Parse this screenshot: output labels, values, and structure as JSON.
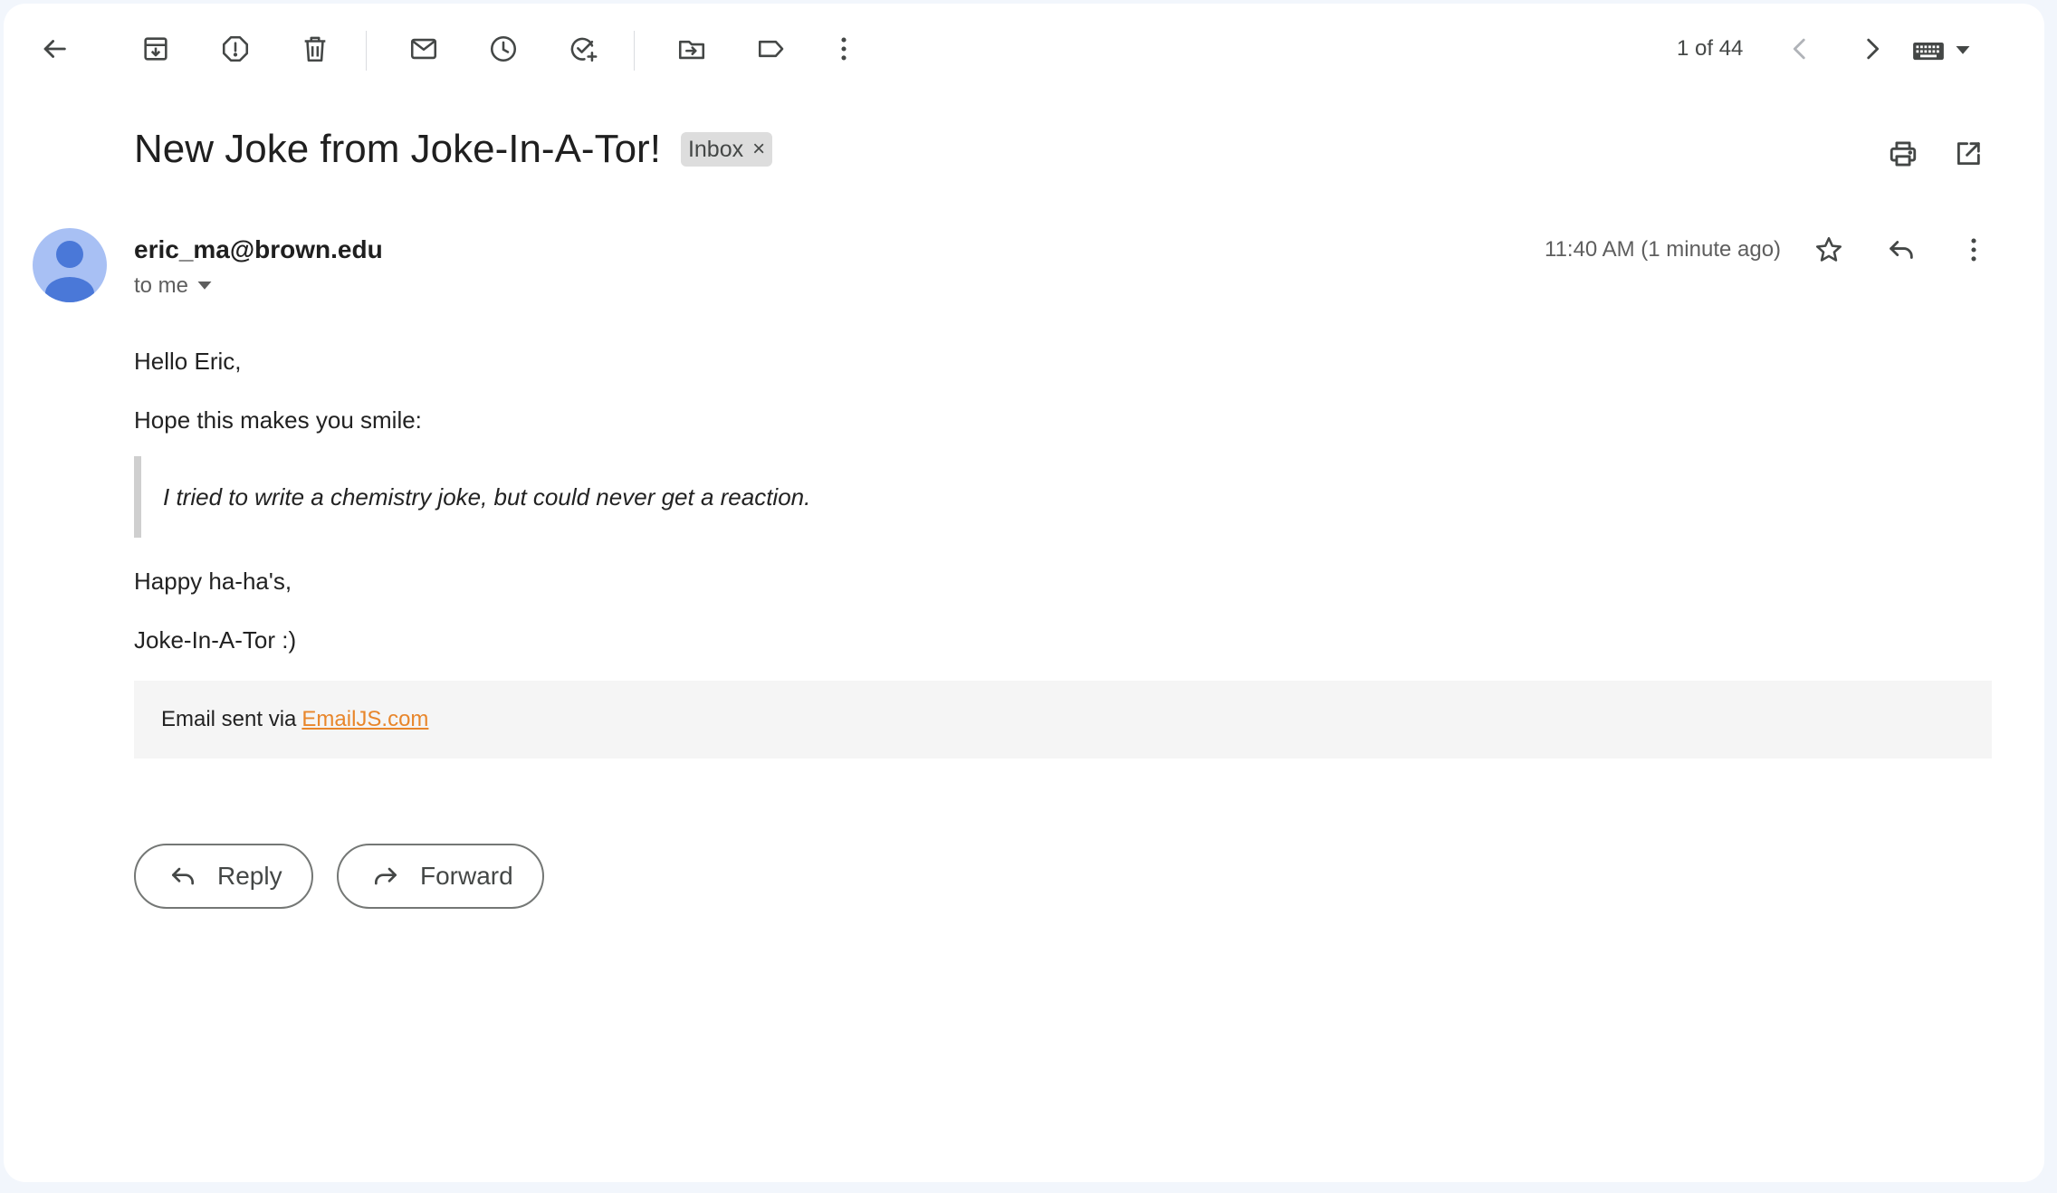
{
  "toolbar": {
    "pager": "1 of 44",
    "icons": [
      "back-arrow-icon",
      "archive-icon",
      "report-spam-icon",
      "delete-icon",
      "mark-unread-icon",
      "snooze-icon",
      "add-to-tasks-icon",
      "move-to-icon",
      "label-icon",
      "more-vert-icon",
      "chevron-left-icon",
      "chevron-right-icon",
      "keyboard-icon"
    ]
  },
  "email": {
    "subject": "New Joke from Joke-In-A-Tor!",
    "label_chip": "Inbox",
    "label_chip_close": "×",
    "sender": "eric_ma@brown.edu",
    "recipient": "to me",
    "time": "11:40 AM (1 minute ago)",
    "body": {
      "greeting": "Hello Eric,",
      "intro": "Hope this makes you smile:",
      "joke": "I tried to write a chemistry joke, but could never get a reaction.",
      "signoff": "Happy ha-ha's,",
      "signature": "Joke-In-A-Tor :)"
    },
    "footer": {
      "prefix": "Email sent via",
      "link_text": "EmailJS.com"
    }
  },
  "actions": {
    "reply_label": "Reply",
    "forward_label": "Forward"
  },
  "colors": {
    "background": "#f2f6fc",
    "panel": "#ffffff",
    "avatar_bg": "#a8c0f4",
    "avatar_fg": "#4a78d8",
    "link": "#e8862b",
    "chip_bg": "#dddddd"
  }
}
